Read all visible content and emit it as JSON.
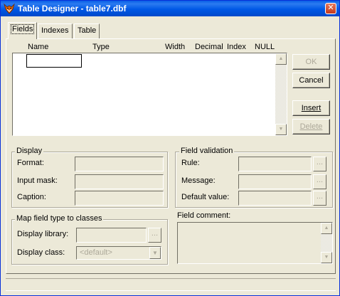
{
  "window": {
    "title": "Table Designer - table7.dbf",
    "close_label": "✕"
  },
  "tabs": [
    {
      "label": "Fields",
      "active": true
    },
    {
      "label": "Indexes",
      "active": false
    },
    {
      "label": "Table",
      "active": false
    }
  ],
  "grid": {
    "columns": [
      "Name",
      "Type",
      "Width",
      "Decimal",
      "Index",
      "NULL"
    ],
    "rows": []
  },
  "buttons": {
    "ok": {
      "label": "OK",
      "enabled": false
    },
    "cancel": {
      "label": "Cancel",
      "enabled": true
    },
    "insert": {
      "label": "Insert",
      "enabled": true
    },
    "delete": {
      "label": "Delete",
      "enabled": false
    }
  },
  "display": {
    "legend": "Display",
    "format_label": "Format:",
    "input_mask_label": "Input mask:",
    "caption_label": "Caption:",
    "format_value": "",
    "input_mask_value": "",
    "caption_value": ""
  },
  "validation": {
    "legend": "Field validation",
    "rule_label": "Rule:",
    "message_label": "Message:",
    "default_label": "Default value:",
    "ellipsis": "...",
    "rule_value": "",
    "message_value": "",
    "default_value": ""
  },
  "mapping": {
    "legend": "Map field type to classes",
    "library_label": "Display library:",
    "class_label": "Display class:",
    "library_value": "",
    "class_value": "<default>",
    "ellipsis": "..."
  },
  "comment": {
    "label": "Field comment:",
    "value": ""
  },
  "icons": {
    "app": "foxpro-fox-icon",
    "close": "close-icon",
    "scroll_up": "scroll-up-arrow-icon",
    "scroll_down": "scroll-down-arrow-icon",
    "combo": "chevron-down-icon"
  },
  "colors": {
    "titlebar": "#0058e6",
    "face": "#ece9d8",
    "disabled_text": "#aca899"
  }
}
